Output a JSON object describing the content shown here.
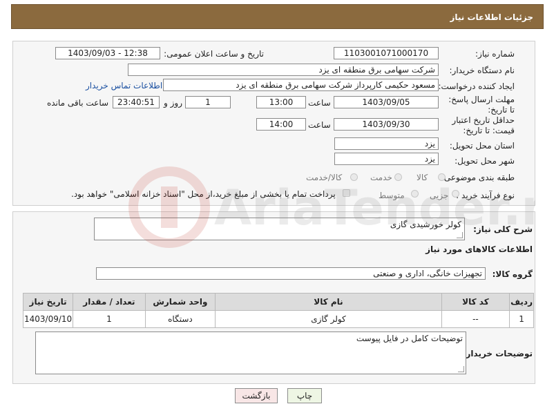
{
  "header": {
    "title": "جزئیات اطلاعات نیاز"
  },
  "form": {
    "need_number": {
      "label": "شماره نیاز:",
      "value": "1103001071000170"
    },
    "announce_datetime": {
      "label": "تاریخ و ساعت اعلان عمومی:",
      "value": "1403/09/03 - 12:38"
    },
    "buyer_org": {
      "label": "نام دستگاه خریدار:",
      "value": "شرکت سهامی برق منطقه ای یزد"
    },
    "requester": {
      "label": "ایجاد کننده درخواست:",
      "value": "مسعود حکیمی کارپرداز شرکت سهامی برق منطقه ای یزد",
      "contact_link": "اطلاعات تماس خریدار"
    },
    "response_deadline": {
      "label": "مهلت ارسال پاسخ: تا تاریخ:",
      "date": "1403/09/05",
      "time_label": "ساعت",
      "time": "13:00",
      "days": "1",
      "days_label": "روز و",
      "remaining_time": "23:40:51",
      "remaining_label": "ساعت باقی مانده"
    },
    "price_validity": {
      "label": "حداقل تاریخ اعتبار قیمت: تا تاریخ:",
      "date": "1403/09/30",
      "time_label": "ساعت",
      "time": "14:00"
    },
    "delivery_province": {
      "label": "استان محل تحویل:",
      "value": "یزد"
    },
    "delivery_city": {
      "label": "شهر محل تحویل:",
      "value": "یزد"
    },
    "category": {
      "label": "طبقه بندی موضوعی:",
      "options": [
        "کالا",
        "خدمت",
        "کالا/خدمت"
      ],
      "selected": "کالا"
    },
    "purchase_type": {
      "label": "نوع فرآیند خرید :",
      "options": [
        "جزیی",
        "متوسط"
      ],
      "payment_note": "پرداخت تمام یا بخشی از مبلغ خرید،از محل \"اسناد خزانه اسلامی\" خواهد بود."
    }
  },
  "details": {
    "general_desc_label": "شرح کلی نیاز:",
    "general_desc_value": "کولر خورشیدی گازی",
    "goods_info_title": "اطلاعات کالاهای مورد نیاز",
    "goods_group_label": "گروه کالا:",
    "goods_group_value": "تجهیزات خانگی، اداری و صنعتی",
    "table": {
      "headers": [
        "ردیف",
        "کد کالا",
        "نام کالا",
        "واحد شمارش",
        "تعداد / مقدار",
        "تاریخ نیاز"
      ],
      "rows": [
        [
          "1",
          "--",
          "کولر گازی",
          "دستگاه",
          "1",
          "1403/09/10"
        ]
      ]
    },
    "buyer_notes_label": "توضیحات خریدار:",
    "buyer_notes_value": "توضیحات کامل در فایل پیوست"
  },
  "buttons": {
    "print": "چاپ",
    "back": "بازگشت"
  },
  "watermark": {
    "text": "AriaTender.neT"
  }
}
